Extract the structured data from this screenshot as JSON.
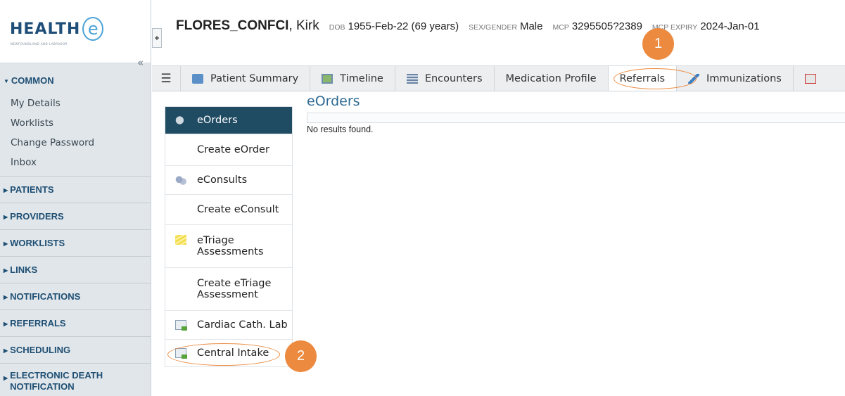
{
  "brand": {
    "logo_text": "HEALTH",
    "logo_mark": "e",
    "logo_tagline": "NEWFOUNDLAND AND LABRADOR"
  },
  "sidebar": {
    "collapse_icon": "«",
    "sections": [
      {
        "label": "COMMON",
        "expanded": true,
        "items": [
          "My Details",
          "Worklists",
          "Change Password",
          "Inbox"
        ]
      },
      {
        "label": "PATIENTS"
      },
      {
        "label": "PROVIDERS"
      },
      {
        "label": "WORKLISTS"
      },
      {
        "label": "LINKS"
      },
      {
        "label": "NOTIFICATIONS"
      },
      {
        "label": "REFERRALS"
      },
      {
        "label": "SCHEDULING"
      },
      {
        "label": "ELECTRONIC DEATH NOTIFICATION"
      }
    ]
  },
  "patient": {
    "family_name": "FLORES_CONFCI",
    "given_name": ", Kirk",
    "dob_label": "DOB",
    "dob_value": "1955-Feb-22 (69 years)",
    "sex_label": "SEX/GENDER",
    "sex_value": "Male",
    "mcp_label": "MCP",
    "mcp_value": "3295505?2389",
    "mcp_expiry_label": "MCP EXPIRY",
    "mcp_expiry_value": "2024-Jan-01"
  },
  "tabs": [
    {
      "label": "Patient Summary",
      "icon": "summary-icon"
    },
    {
      "label": "Timeline",
      "icon": "timeline-icon"
    },
    {
      "label": "Encounters",
      "icon": "encounters-icon"
    },
    {
      "label": "Medication Profile"
    },
    {
      "label": "Referrals",
      "active": true
    },
    {
      "label": "Immunizations",
      "icon": "syringe-icon"
    },
    {
      "label": "",
      "icon": "pdf-icon"
    }
  ],
  "referral_menu": [
    {
      "label": "eOrders",
      "icon": "eorders-icon",
      "active": true
    },
    {
      "label": "Create eOrder"
    },
    {
      "label": "eConsults",
      "icon": "econsults-icon"
    },
    {
      "label": "Create eConsult"
    },
    {
      "label": "eTriage Assessments",
      "icon": "etriage-icon"
    },
    {
      "label": "Create eTriage Assessment"
    },
    {
      "label": "Cardiac Cath. Lab",
      "icon": "document-icon"
    },
    {
      "label": "Central Intake",
      "icon": "document-icon"
    }
  ],
  "content": {
    "title": "eOrders",
    "empty_message": "No results found."
  },
  "annotations": {
    "step1": "1",
    "step2": "2"
  },
  "colors": {
    "accent_orange": "#ec8a3f",
    "nav_active": "#1f4b63",
    "heading_blue": "#2f6a92"
  }
}
